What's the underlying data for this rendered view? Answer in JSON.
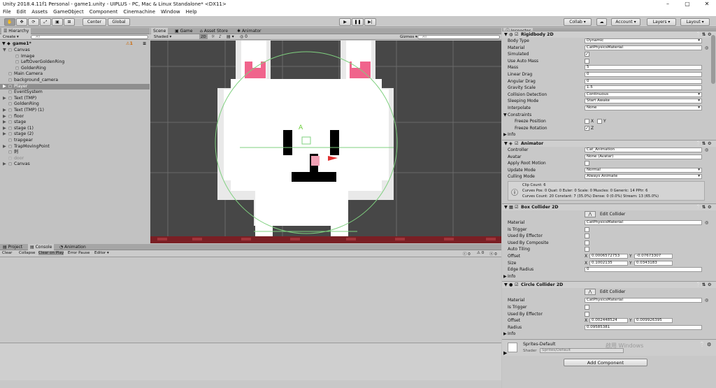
{
  "window": {
    "title": "Unity 2018.4.11f1 Personal - game1.unity - UIPLUS - PC, Mac & Linux Standalone* <DX11>"
  },
  "menu": [
    "File",
    "Edit",
    "Assets",
    "GameObject",
    "Component",
    "Cinemachine",
    "Window",
    "Help"
  ],
  "toolbar": {
    "center": "Center",
    "global": "Global",
    "collab": "Collab",
    "account": "Account",
    "layers": "Layers",
    "layout": "Layout"
  },
  "hierarchy": {
    "tab": "Hierarchy",
    "create": "Create",
    "search_placeholder": "All",
    "scene": "game1*",
    "badge": "1",
    "items": [
      {
        "label": "Canvas",
        "depth": 1
      },
      {
        "label": "Image",
        "depth": 2
      },
      {
        "label": "LeftOverGoldenRing",
        "depth": 2
      },
      {
        "label": "GoldenRing",
        "depth": 2
      },
      {
        "label": "Main Camera",
        "depth": 1
      },
      {
        "label": "background_camera",
        "depth": 1
      },
      {
        "label": "Player",
        "depth": 1,
        "selected": true
      },
      {
        "label": "EventSystem",
        "depth": 1
      },
      {
        "label": "Text (TMP)",
        "depth": 1
      },
      {
        "label": "GoldenRing",
        "depth": 1
      },
      {
        "label": "Text (TMP) (1)",
        "depth": 1
      },
      {
        "label": "floor",
        "depth": 1
      },
      {
        "label": "stage",
        "depth": 1
      },
      {
        "label": "stage (1)",
        "depth": 1
      },
      {
        "label": "stage (2)",
        "depth": 1
      },
      {
        "label": "trapgear",
        "depth": 1
      },
      {
        "label": "TrapMovingPoint",
        "depth": 1
      },
      {
        "label": "刺",
        "depth": 1
      },
      {
        "label": "door",
        "depth": 1,
        "dim": true
      },
      {
        "label": "Canvas",
        "depth": 1
      }
    ]
  },
  "scene": {
    "tabs": [
      "Scene",
      "Game",
      "Asset Store",
      "Animator"
    ],
    "shading": "Shaded",
    "mode2d": "2D",
    "gizmos": "Gizmos",
    "search_placeholder": "All"
  },
  "console": {
    "tabs": [
      "Project",
      "Console",
      "Animation"
    ],
    "buttons": [
      "Clear",
      "Collapse",
      "Clear on Play",
      "Error Pause",
      "Editor"
    ],
    "counts": [
      "0",
      "0",
      "0"
    ]
  },
  "inspector": {
    "tab": "Inspector",
    "rigidbody": {
      "title": "Rigidbody 2D",
      "rows": [
        {
          "label": "Body Type",
          "value": "Dynamic"
        },
        {
          "label": "Material",
          "value": "CatPhysicsMaterial"
        },
        {
          "label": "Simulated",
          "check": "✓"
        },
        {
          "label": "Use Auto Mass",
          "check": ""
        },
        {
          "label": "Mass",
          "value": "5"
        },
        {
          "label": "Linear Drag",
          "value": "0"
        },
        {
          "label": "Angular Drag",
          "value": "0"
        },
        {
          "label": "Gravity Scale",
          "value": "1.5"
        },
        {
          "label": "Collision Detection",
          "value": "Continuous"
        },
        {
          "label": "Sleeping Mode",
          "value": "Start Awake"
        },
        {
          "label": "Interpolate",
          "value": "None"
        },
        {
          "label": "Constraints"
        },
        {
          "label": "Freeze Position",
          "xy": [
            "X",
            "Y"
          ]
        },
        {
          "label": "Freeze Rotation",
          "z": "Z"
        },
        {
          "label": "Info"
        }
      ]
    },
    "animator": {
      "title": "Animator",
      "rows": [
        {
          "label": "Controller",
          "value": "Cat_Animation"
        },
        {
          "label": "Avatar",
          "value": "None (Avatar)"
        },
        {
          "label": "Apply Root Motion",
          "check": ""
        },
        {
          "label": "Update Mode",
          "value": "Normal"
        },
        {
          "label": "Culling Mode",
          "value": "Always Animate"
        }
      ],
      "info": [
        "Clip Count: 6",
        "Curves Pos: 0 Quat: 0 Euler: 0 Scale: 0 Muscles: 0 Generic: 14 PPtr: 6",
        "Curves Count: 20 Constant: 7 (35.0%) Dense: 0 (0.0%) Stream: 13 (65.0%)"
      ]
    },
    "box": {
      "title": "Box Collider 2D",
      "edit": "Edit Collider",
      "rows": [
        {
          "label": "Material",
          "value": "CatPhysicsMaterial"
        },
        {
          "label": "Is Trigger",
          "check": ""
        },
        {
          "label": "Used By Effector",
          "check": ""
        },
        {
          "label": "Used By Composite",
          "check": ""
        },
        {
          "label": "Auto Tiling",
          "check": ""
        },
        {
          "label": "Offset",
          "x": "0.0006572753",
          "y": "-0.07673307"
        },
        {
          "label": "Size",
          "x": "0.1002135",
          "y": "0.0343183"
        },
        {
          "label": "Edge Radius",
          "value": "0"
        },
        {
          "label": "Info"
        }
      ]
    },
    "circle": {
      "title": "Circle Collider 2D",
      "edit": "Edit Collider",
      "rows": [
        {
          "label": "Material",
          "value": "CatPhysicsMaterial"
        },
        {
          "label": "Is Trigger",
          "check": ""
        },
        {
          "label": "Used By Effector",
          "check": ""
        },
        {
          "label": "Offset",
          "x": "0.002448524",
          "y": "0.009926395"
        },
        {
          "label": "Radius",
          "value": "0.09585381"
        },
        {
          "label": "Info"
        }
      ]
    },
    "material": {
      "name": "Sprites-Default",
      "shader_label": "Shader",
      "shader": "Sprites/Default"
    },
    "add_component": "Add Component",
    "watermark": "啟用 Windows"
  }
}
